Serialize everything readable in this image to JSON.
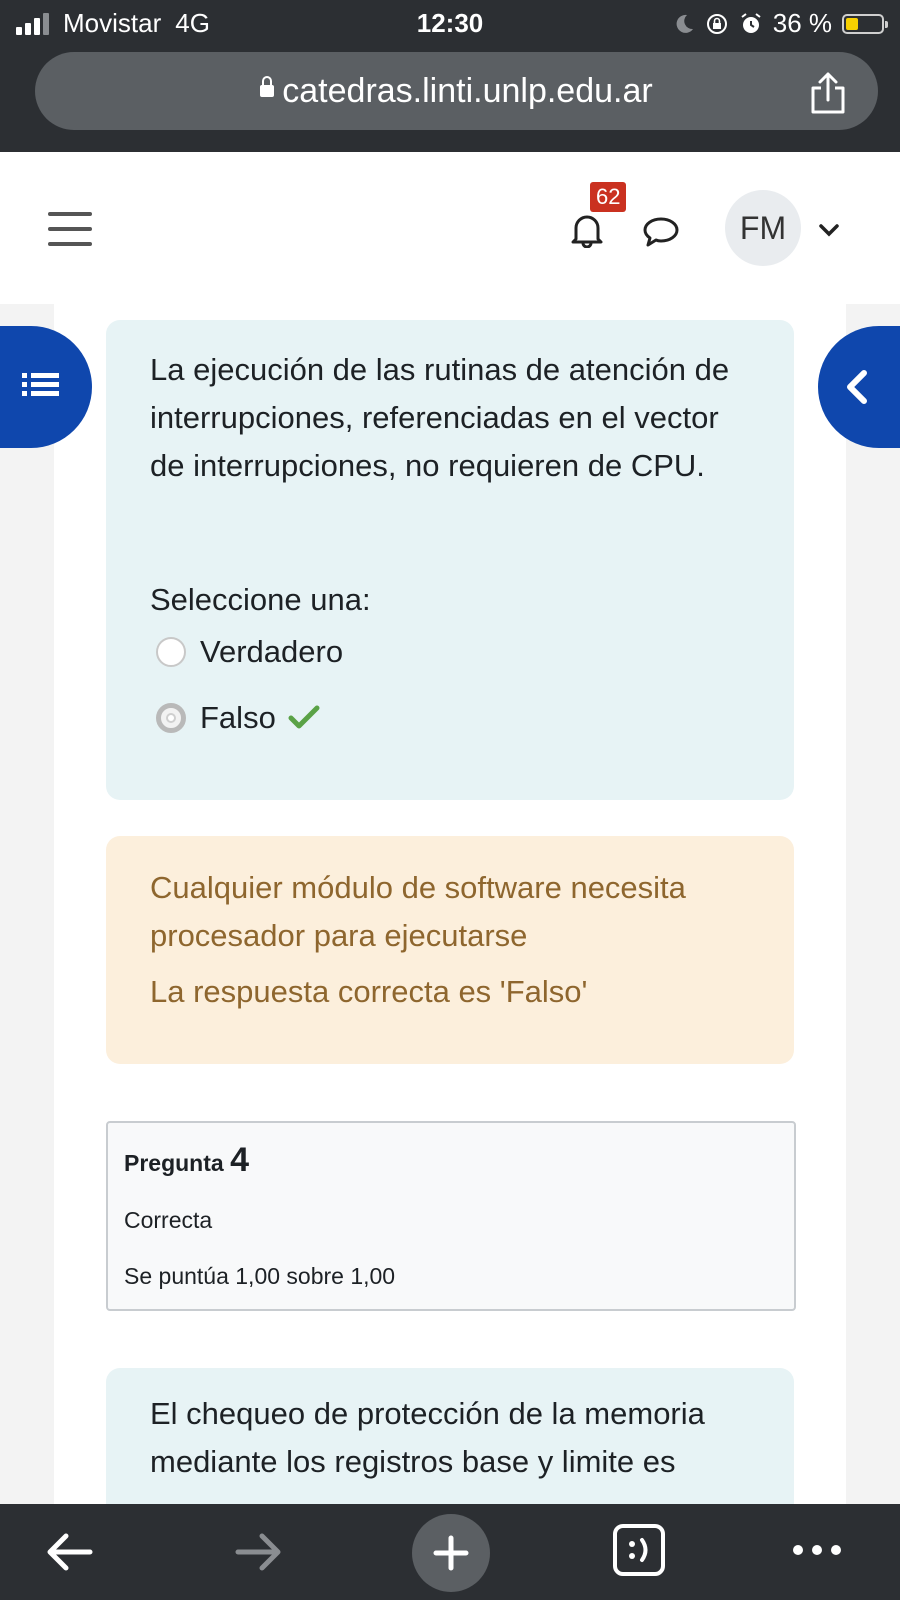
{
  "status_bar": {
    "carrier": "Movistar",
    "network": "4G",
    "time": "12:30",
    "battery": "36 %",
    "battery_level": 0.36
  },
  "browser": {
    "url": "catedras.linti.unlp.edu.ar"
  },
  "header": {
    "notifications_count": "62",
    "user_initials": "FM"
  },
  "question3": {
    "text": "La ejecución de las rutinas de atención de interrupciones, referenciadas en el vector de interrupciones, no requieren de CPU.",
    "prompt": "Seleccione una:",
    "options": [
      {
        "label": "Verdadero",
        "selected": false
      },
      {
        "label": "Falso",
        "selected": true,
        "correct": true
      }
    ],
    "feedback": "Cualquier módulo de software necesita procesador para ejecutarse",
    "correct_answer": "La respuesta correcta es 'Falso'"
  },
  "question4": {
    "label": "Pregunta",
    "number": "4",
    "state": "Correcta",
    "grade": "Se puntúa 1,00 sobre 1,00",
    "text": "El chequeo de protección de la memoria mediante los registros base y limite es"
  },
  "colors": {
    "accent": "#0f47ad",
    "question_bg": "#e7f3f5",
    "feedback_bg": "#fcefdc",
    "feedback_text": "#8e662e",
    "correct": "#5aa246",
    "badge": "#ca3120"
  }
}
